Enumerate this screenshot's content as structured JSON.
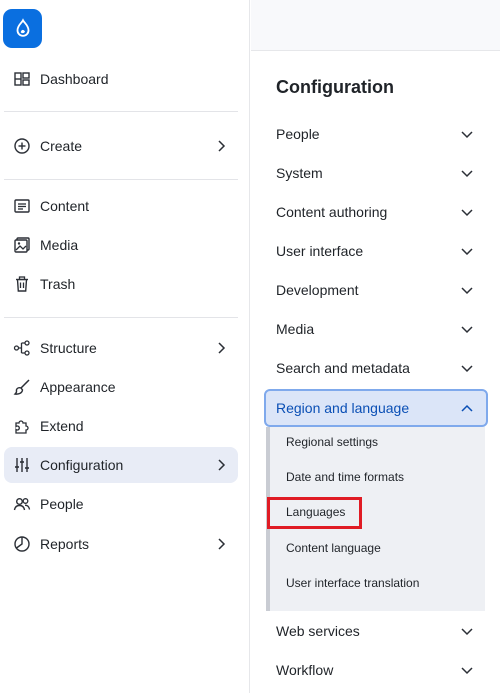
{
  "sidebar": {
    "items": [
      {
        "label": "Dashboard",
        "icon": "dashboard-icon"
      },
      {
        "label": "Create",
        "icon": "plus-circle-icon"
      },
      {
        "label": "Content",
        "icon": "document-icon"
      },
      {
        "label": "Media",
        "icon": "image-icon"
      },
      {
        "label": "Trash",
        "icon": "trash-icon"
      },
      {
        "label": "Structure",
        "icon": "structure-icon"
      },
      {
        "label": "Appearance",
        "icon": "brush-icon"
      },
      {
        "label": "Extend",
        "icon": "puzzle-icon"
      },
      {
        "label": "Configuration",
        "icon": "sliders-icon"
      },
      {
        "label": "People",
        "icon": "people-icon"
      },
      {
        "label": "Reports",
        "icon": "pie-chart-icon"
      }
    ]
  },
  "panel": {
    "title": "Configuration",
    "items": [
      {
        "label": "People"
      },
      {
        "label": "System"
      },
      {
        "label": "Content authoring"
      },
      {
        "label": "User interface"
      },
      {
        "label": "Development"
      },
      {
        "label": "Media"
      },
      {
        "label": "Search and metadata"
      },
      {
        "label": "Region and language"
      },
      {
        "label": "Web services"
      },
      {
        "label": "Workflow"
      }
    ],
    "submenu": [
      {
        "label": "Regional settings"
      },
      {
        "label": "Date and time formats"
      },
      {
        "label": "Languages"
      },
      {
        "label": "Content language"
      },
      {
        "label": "User interface translation"
      }
    ]
  },
  "colors": {
    "brand": "#0a6fe0",
    "active_bg": "#e8ecf6",
    "expanded_bg": "#dbe5f8",
    "expanded_text": "#0a4fb5",
    "highlight": "#e01b24"
  }
}
